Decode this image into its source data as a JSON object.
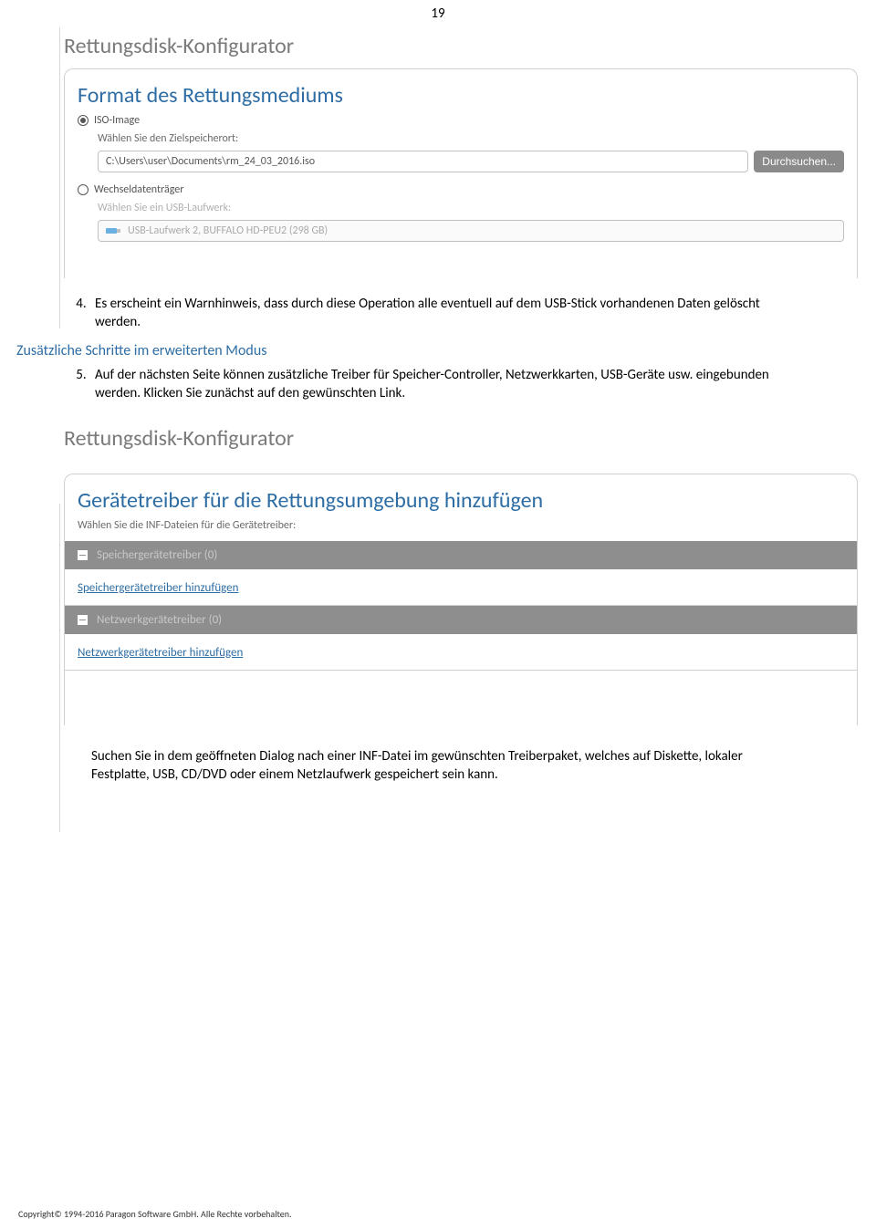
{
  "page_number": "19",
  "screenshot1": {
    "window_title": "Rettungsdisk-Konfigurator",
    "heading": "Format des Rettungsmediums",
    "option_iso": "ISO-Image",
    "target_label": "Wählen Sie den Zielspeicherort:",
    "target_path": "C:\\Users\\user\\Documents\\rm_24_03_2016.iso",
    "browse": "Durchsuchen...",
    "option_removable": "Wechseldatenträger",
    "usb_label": "Wählen Sie ein USB-Laufwerk:",
    "usb_value": "USB-Laufwerk 2, BUFFALO HD-PEU2 (298 GB)"
  },
  "body": {
    "item4": "Es erscheint ein Warnhinweis, dass durch diese Operation alle eventuell auf dem USB-Stick vorhandenen Daten gelöscht werden.",
    "subheading": "Zusätzliche Schritte im erweiterten Modus",
    "item5": "Auf der nächsten Seite können zusätzliche Treiber für Speicher-Controller, Netzwerkkarten, USB-Geräte usw. eingebunden werden. Klicken Sie zunächst auf den gewünschten Link."
  },
  "screenshot2": {
    "window_title": "Rettungsdisk-Konfigurator",
    "heading": "Gerätetreiber für die Rettungsumgebung hinzufügen",
    "subtext": "Wählen Sie die INF-Dateien für die Gerätetreiber:",
    "group1": "Speichergerätetreiber (0)",
    "link1": "Speichergerätetreiber hinzufügen",
    "group2": "Netzwerkgerätetreiber (0)",
    "link2": "Netzwerkgerätetreiber hinzufügen"
  },
  "post_text": "Suchen Sie in dem geöffneten Dialog nach einer INF-Datei im gewünschten Treiberpaket, welches auf Diskette, lokaler Festplatte, USB, CD/DVD oder einem Netzlaufwerk gespeichert sein kann.",
  "footer": "Copyright© 1994-2016 Paragon Software GmbH. Alle Rechte vorbehalten."
}
